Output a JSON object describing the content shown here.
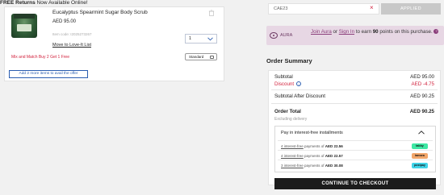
{
  "banner": {
    "strong": "FREE Returns",
    "rest": " Now Available Online!"
  },
  "cart_item": {
    "title": "Eucalyptus Spearmint Sugar Body Scrub",
    "price": "AED  95.00",
    "item_code": "Item code: I2025273267",
    "move_link": "Move to Love-It List",
    "quantity": "1",
    "promo": "Mix and Match Buy 2 Get 1 Free",
    "shipping_tag": "Standard",
    "add_more": "Add 2 more items to avail the offer"
  },
  "coupon": {
    "code": "CAE23",
    "applied_label": "APPLIED"
  },
  "aura": {
    "logo": "AURA",
    "join": "Join Aura",
    "or": " or ",
    "sign_in": "Sign In",
    "to_earn": " to earn ",
    "points": "90",
    "rest": " points on this purchase.",
    "help": "?"
  },
  "summary": {
    "title": "Order Summary",
    "subtotal_label": "Subtotal",
    "subtotal_value": "AED  95.00",
    "discount_label": "Discount",
    "discount_value": "AED  -4.75",
    "after_label": "Subtotal After Discount",
    "after_value": "AED  90.25",
    "total_label": "Order Total",
    "total_value": "AED  90.25",
    "excluding": "Excluding delivery"
  },
  "installments": {
    "header": "Pay in interest-free installments",
    "rows": [
      {
        "count": "4 interest-free",
        "text": " payments of ",
        "amount": "AED 22.56",
        "provider": "tabby",
        "color": "#3de8a4",
        "fg": "#111"
      },
      {
        "count": "4 interest-free",
        "text": " payments of ",
        "amount": "AED 22.57",
        "provider": "tamara",
        "color": "#f2a66a",
        "fg": "#111"
      },
      {
        "count": "3 interest-free",
        "text": " payments of ",
        "amount": "AED 30.08",
        "provider": "postpay",
        "color": "#3fd3e8",
        "fg": "#111"
      }
    ]
  },
  "checkout_label": "CONTINUE TO CHECKOUT",
  "colors": {
    "accent_red": "#d2233e",
    "aura_purple": "#8a3d7a",
    "link_blue": "#2a5db0"
  }
}
